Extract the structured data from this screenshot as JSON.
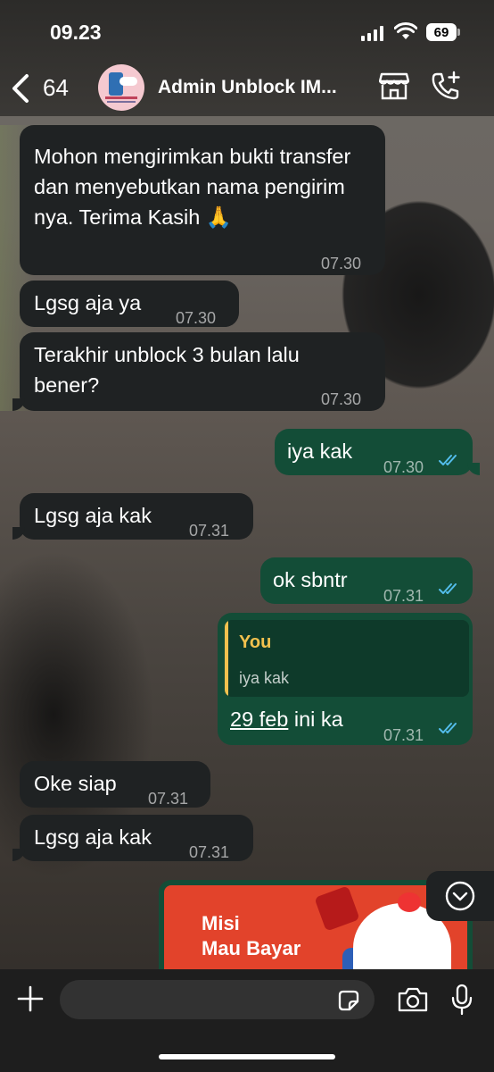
{
  "status": {
    "time": "09.23",
    "battery": "69"
  },
  "header": {
    "back_count": "64",
    "title": "Admin Unblock IM..."
  },
  "messages": [
    {
      "dir": "in",
      "text": "Mohon mengirimkan bukti transfer dan menyebutkan nama pengirim nya. Terima Kasih 🙏",
      "time": "07.30"
    },
    {
      "dir": "in",
      "text": "Lgsg aja ya",
      "time": "07.30"
    },
    {
      "dir": "in",
      "text": "Terakhir unblock 3 bulan lalu bener?",
      "time": "07.30"
    },
    {
      "dir": "out",
      "text": "iya kak",
      "time": "07.30"
    },
    {
      "dir": "in",
      "text": "Lgsg aja kak",
      "time": "07.31"
    },
    {
      "dir": "out",
      "text": "ok sbntr",
      "time": "07.31"
    },
    {
      "dir": "out",
      "reply_to": {
        "author": "You",
        "text": "iya kak"
      },
      "text": "29 feb ini ka",
      "link": "29 feb",
      "time": "07.31"
    },
    {
      "dir": "in",
      "text": "Oke siap",
      "time": "07.31"
    },
    {
      "dir": "in",
      "text": "Lgsg aja kak",
      "time": "07.31"
    }
  ],
  "promo_image": {
    "line1": "Misi",
    "line2": "Mau Bayar"
  },
  "input": {
    "placeholder": ""
  },
  "colors": {
    "incoming": "#1f2223",
    "outgoing": "#134d37",
    "read_ticks": "#53bdeb",
    "reply_name": "#f2c14e"
  },
  "icons": [
    "back-chevron-icon",
    "store-icon",
    "add-call-icon",
    "chevron-down-icon",
    "plus-icon",
    "sticker-icon",
    "camera-icon",
    "mic-icon",
    "double-check-icon"
  ]
}
